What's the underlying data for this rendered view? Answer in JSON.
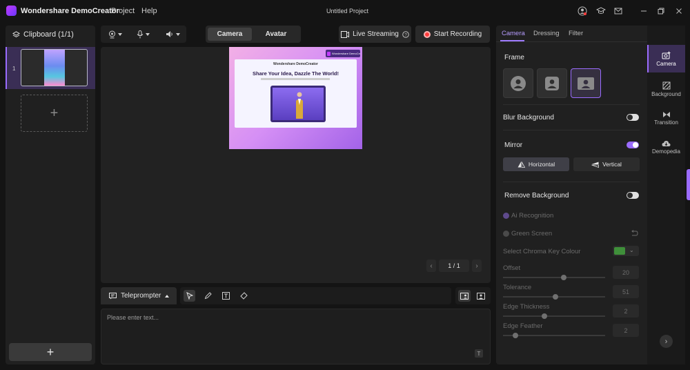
{
  "app": {
    "name": "Wondershare DemoCreator",
    "menu": [
      "Project",
      "Help"
    ],
    "document_title": "Untitled Project"
  },
  "clipboard": {
    "header": "Clipboard (1/1)",
    "items": [
      {
        "index": "1"
      }
    ]
  },
  "modes": {
    "camera": "Camera",
    "avatar": "Avatar"
  },
  "actions": {
    "live_streaming": "Live Streaming",
    "start_recording": "Start Recording"
  },
  "preview": {
    "brand": "Wondershare DemoCreator",
    "headline": "Share Your Idea, Dazzle The World!"
  },
  "pager": {
    "text": "1 / 1"
  },
  "teleprompter": {
    "tab_label": "Teleprompter",
    "placeholder": "Please enter text..."
  },
  "settings": {
    "tabs": [
      "Camera",
      "Dressing",
      "Filter"
    ],
    "frame_label": "Frame",
    "blur_background": "Blur Background",
    "mirror": "Mirror",
    "mirror_horizontal": "Horizontal",
    "mirror_vertical": "Vertical",
    "remove_background": "Remove Background",
    "ai_recognition": "Ai Recognition",
    "green_screen": "Green Screen",
    "chroma_key": "Select Chroma Key Colour",
    "offset": {
      "label": "Offset",
      "value": "20"
    },
    "tolerance": {
      "label": "Tolerance",
      "value": "51"
    },
    "edge_thickness": {
      "label": "Edge Thickness",
      "value": "2"
    },
    "edge_feather": {
      "label": "Edge Feather",
      "value": "2"
    },
    "toggles": {
      "blur": false,
      "mirror": true,
      "remove_bg": false
    },
    "chroma_color": "#3f8f3a"
  },
  "sidebar": {
    "camera": "Camera",
    "background": "Background",
    "transition": "Transition",
    "demopedia": "Demopedia"
  },
  "colors": {
    "accent": "#9b6cff",
    "record": "#ff3b3b"
  }
}
